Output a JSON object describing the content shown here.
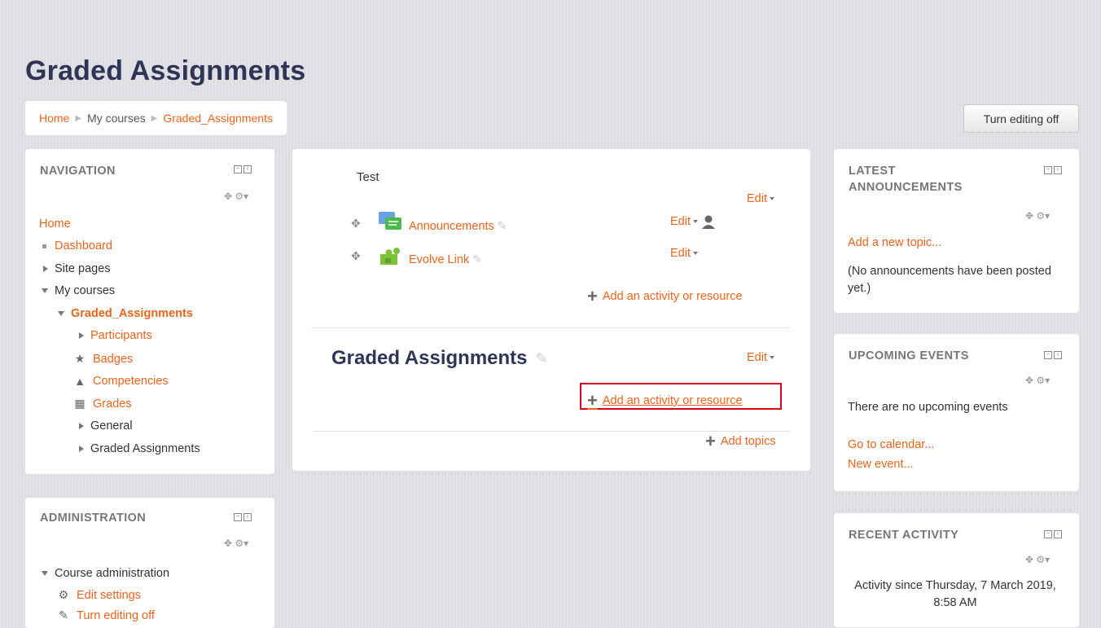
{
  "page": {
    "title": "Graded Assignments"
  },
  "breadcrumb": [
    "Home",
    "My courses",
    "Graded_Assignments"
  ],
  "header": {
    "editing_button": "Turn editing off"
  },
  "navigation": {
    "title": "NAVIGATION",
    "items": [
      {
        "label": "Home"
      },
      {
        "label": "Dashboard"
      },
      {
        "label": "Site pages"
      },
      {
        "label": "My courses"
      },
      {
        "label": "Graded_Assignments"
      },
      {
        "label": "Participants"
      },
      {
        "label": "Badges"
      },
      {
        "label": "Competencies"
      },
      {
        "label": "Grades"
      },
      {
        "label": "General"
      },
      {
        "label": "Graded Assignments"
      }
    ]
  },
  "administration": {
    "title": "ADMINISTRATION",
    "items": [
      {
        "label": "Course administration"
      },
      {
        "label": "Edit settings"
      },
      {
        "label": "Turn editing off"
      }
    ]
  },
  "course": {
    "section1": {
      "name": "Test",
      "edit": "Edit",
      "activities": [
        {
          "name": "Announcements",
          "edit": "Edit"
        },
        {
          "name": "Evolve Link",
          "edit": "Edit"
        }
      ],
      "add_activity": "Add an activity or resource"
    },
    "section2": {
      "name": "Graded Assignments",
      "edit": "Edit",
      "add_activity": "Add an activity or resource"
    },
    "add_topics": "Add topics"
  },
  "latest_announcements": {
    "title": "LATEST ANNOUNCEMENTS",
    "add_link": "Add a new topic...",
    "empty": "(No announcements have been posted yet.)"
  },
  "upcoming_events": {
    "title": "UPCOMING EVENTS",
    "empty": "There are no upcoming events",
    "calendar_link": "Go to calendar...",
    "new_event_link": "New event..."
  },
  "recent_activity": {
    "title": "RECENT ACTIVITY",
    "since": "Activity since Thursday, 7 March 2019, 8:58 AM"
  },
  "colors": {
    "link": "#e8651b",
    "title": "#2f3557",
    "highlight": "#d9001b"
  }
}
